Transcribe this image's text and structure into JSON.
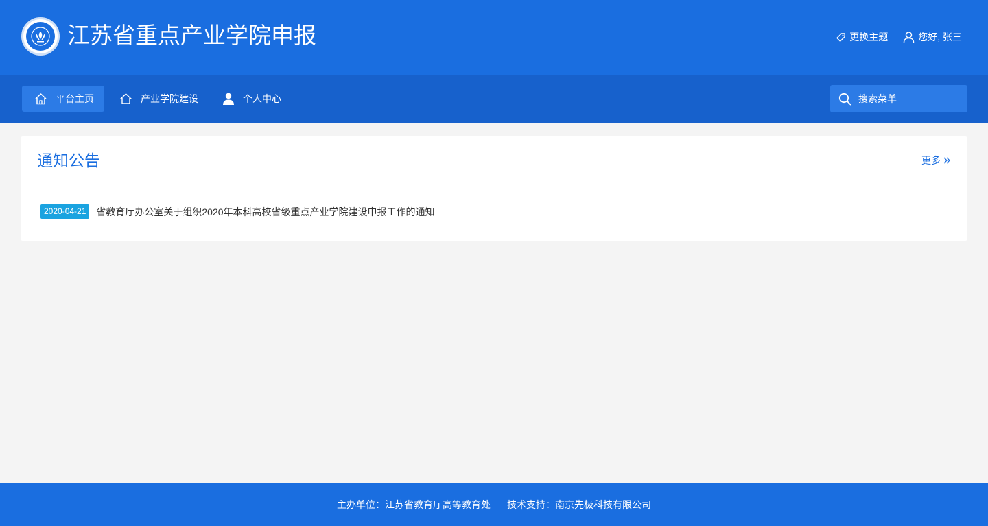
{
  "header": {
    "title": "江苏省重点产业学院申报",
    "logo_icon": "university-emblem-icon",
    "theme_icon": "tag-icon",
    "theme_label": "更换主题",
    "user_icon": "user-icon",
    "greeting": "您好, 张三"
  },
  "nav": {
    "items": [
      {
        "label": "平台主页",
        "icon": "home-icon",
        "active": true
      },
      {
        "label": "产业学院建设",
        "icon": "home-outline-icon",
        "active": false
      },
      {
        "label": "个人中心",
        "icon": "person-icon",
        "active": false
      }
    ],
    "search": {
      "placeholder": "搜索菜单",
      "icon": "search-icon"
    }
  },
  "notices": {
    "title": "通知公告",
    "more_label": "更多",
    "more_icon": "double-chevron-right-icon",
    "items": [
      {
        "date": "2020-04-21",
        "title": "省教育厅办公室关于组织2020年本科高校省级重点产业学院建设申报工作的通知"
      }
    ]
  },
  "footer": {
    "host_label": "主办单位：",
    "host_value": "江苏省教育厅高等教育处",
    "tech_label": "技术支持：",
    "tech_value": "南京先极科技有限公司"
  },
  "colors": {
    "header_bg": "#1a6ee0",
    "nav_bg": "#1761cc",
    "nav_active_bg": "#2c7be6",
    "accent": "#1a6ee0",
    "date_badge_bg": "#1aa3e0",
    "page_bg": "#f4f4f4"
  }
}
